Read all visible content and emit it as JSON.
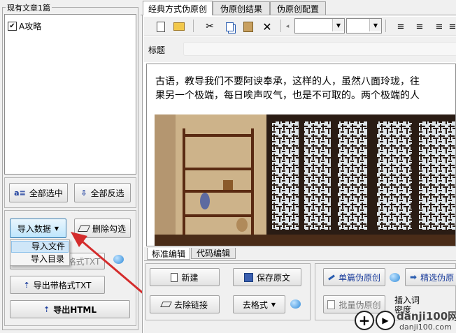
{
  "left_panel": {
    "title": "现有文章1篇",
    "articles": [
      {
        "label": "A攻略",
        "checked": true
      }
    ],
    "buttons": {
      "select_all": "全部选中",
      "invert_select": "全部反选",
      "import_data": "导入数据",
      "delete_checked": "删除勾选",
      "import_format_hidden": "导入带格式TXT",
      "export_format_txt": "导出带格式TXT",
      "export_html": "导出HTML"
    },
    "import_menu": [
      "导入文件",
      "导入目录"
    ]
  },
  "tabs": [
    "经典方式伪原创",
    "伪原创结果",
    "伪原创配置"
  ],
  "editor": {
    "title_label": "标题",
    "title_value": "",
    "body_line1": "古语，教导我们不要阿谀奉承，这样的人，虽然八面玲珑，往",
    "body_line2": "果另一个极端，每日唉声叹气，也是不可取的。两个极端的人"
  },
  "edit_tabs": [
    "标准编辑",
    "代码编辑"
  ],
  "bottom_buttons": {
    "new": "新建",
    "save_original": "保存原文",
    "remove_links": "去除链接",
    "remove_format": "去格式",
    "single_rewrite": "单篇伪原创",
    "precise_select": "精选伪原",
    "batch_rewrite": "批量伪原创",
    "insert_density_1": "插入词",
    "insert_density_2": "密度"
  },
  "watermark": {
    "brand": "danji100网",
    "domain": "danji100.com"
  },
  "colors": {
    "arrow": "#d42c2c",
    "menu_highlight": "#cfe6f8",
    "link_blue": "#1a3c9c"
  }
}
